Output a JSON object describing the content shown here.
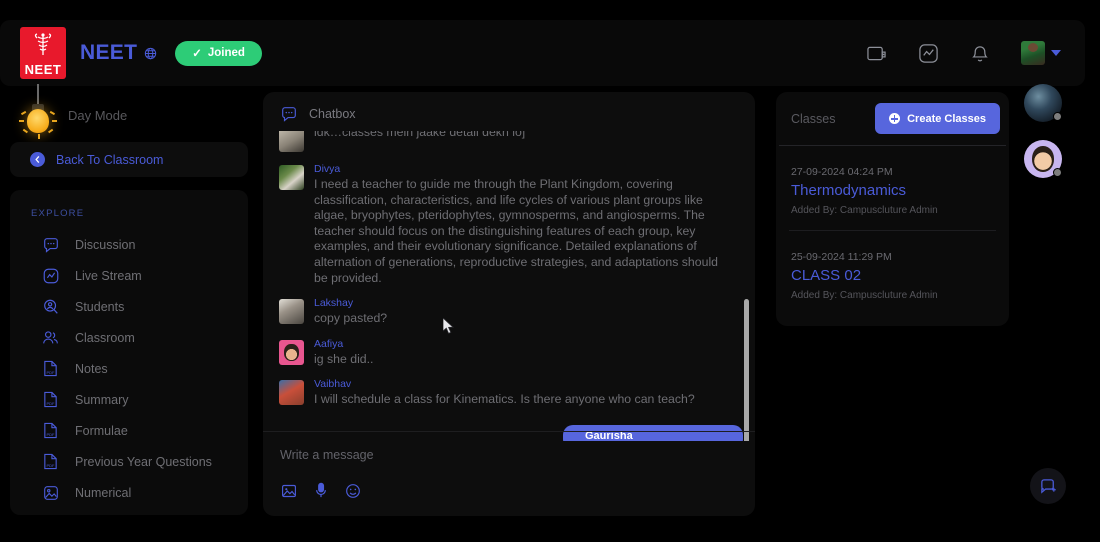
{
  "topbar": {
    "logo_text": "NEET",
    "logo_icon": "caduceus-icon",
    "brand": "NEET",
    "globe_icon": "globe-icon",
    "joined_label": "Joined",
    "joined_check": "✓",
    "joined_color": "#2dcc77",
    "icons": [
      "wallet-icon",
      "activity-icon",
      "bell-icon"
    ],
    "avatar": "user-avatar"
  },
  "sidebar": {
    "day_mode": "Day Mode",
    "bulb_icon": "lightbulb-icon",
    "back_label": "Back To Classroom",
    "back_icon": "chevron-left-icon",
    "explore_title": "EXPLORE",
    "items": [
      {
        "label": "Discussion",
        "icon": "chat-bubble-icon"
      },
      {
        "label": "Live Stream",
        "icon": "live-stream-icon"
      },
      {
        "label": "Students",
        "icon": "student-search-icon"
      },
      {
        "label": "Classroom",
        "icon": "people-group-icon"
      },
      {
        "label": "Notes",
        "icon": "pdf-file-icon"
      },
      {
        "label": "Summary",
        "icon": "pdf-file-icon"
      },
      {
        "label": "Formulae",
        "icon": "pdf-file-icon"
      },
      {
        "label": "Previous Year Questions",
        "icon": "pdf-file-icon"
      },
      {
        "label": "Numerical",
        "icon": "image-file-icon"
      }
    ]
  },
  "chat": {
    "header": "Chatbox",
    "header_icon": "chat-bubble-icon",
    "messages": [
      {
        "name": "",
        "text": "idk…classes mein jaake detail dekh lo]",
        "avatar": "a1"
      },
      {
        "name": "Divya",
        "text": "I need a teacher to guide me through the Plant Kingdom, covering classification, characteristics, and life cycles of various plant groups like algae, bryophytes, pteridophytes, gymnosperms, and angiosperms. The teacher should focus on the distinguishing features of each group, key examples, and their evolutionary significance. Detailed explanations of alternation of generations, reproductive strategies, and adaptations should be provided.",
        "avatar": "a2"
      },
      {
        "name": "Lakshay",
        "text": "copy pasted?",
        "avatar": "a3"
      },
      {
        "name": "Aafiya",
        "text": "ig she did..",
        "avatar": "a4"
      },
      {
        "name": "Vaibhav",
        "text": "I will schedule a class for Kinematics. Is there anyone who can teach?",
        "avatar": "a5"
      }
    ],
    "peek_bubble": "Gaurisha",
    "composer_placeholder": "Write a message",
    "composer_icons": [
      "image-icon",
      "microphone-icon",
      "emoji-icon"
    ]
  },
  "classes": {
    "title": "Classes",
    "create_label": "Create Classes",
    "create_icon": "plus-circle-icon",
    "items": [
      {
        "date": "27-09-2024 04:24 PM",
        "name": "Thermodynamics",
        "added_by": "Added By: Campuscluture Admin"
      },
      {
        "date": "25-09-2024 11:29 PM",
        "name": "CLASS 02",
        "added_by": "Added By: Campuscluture Admin"
      }
    ]
  },
  "rail": {
    "avatars": [
      "earth-avatar",
      "boy-avatar"
    ],
    "fab_icon": "new-chat-icon"
  },
  "colors": {
    "accent": "#4a5bd8",
    "button": "#5766dd",
    "success": "#2dcc77",
    "logo_red": "#e8192c",
    "page_bg": "#000000",
    "panel_bg": "#0d0d0d"
  }
}
